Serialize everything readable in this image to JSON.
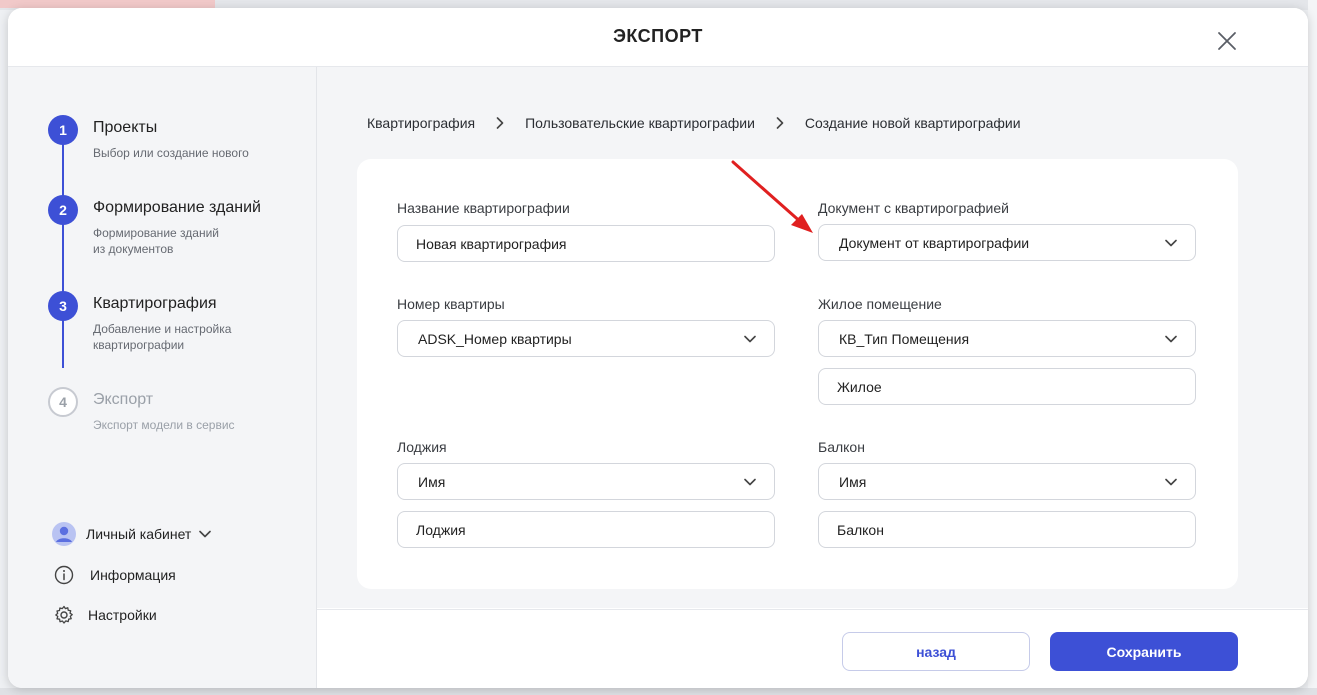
{
  "modal": {
    "title": "ЭКСПОРТ"
  },
  "steps": [
    {
      "number": "1",
      "title": "Проекты",
      "subtitle": "Выбор или создание нового",
      "state": "done"
    },
    {
      "number": "2",
      "title": "Формирование зданий",
      "subtitle": "Формирование зданий\nиз документов",
      "state": "done"
    },
    {
      "number": "3",
      "title": "Квартирография",
      "subtitle": "Добавление и настройка\nквартирографии",
      "state": "active"
    },
    {
      "number": "4",
      "title": "Экспорт",
      "subtitle": "Экспорт модели в сервис",
      "state": "inactive"
    }
  ],
  "side_menu": {
    "account": "Личный кабинет",
    "info": "Информация",
    "settings": "Настройки"
  },
  "breadcrumb": [
    "Квартирография",
    "Пользовательские квартирографии",
    "Создание новой квартирографии"
  ],
  "form": {
    "name_label": "Название квартирографии",
    "name_value": "Новая квартирография",
    "document_label": "Документ с квартирографией",
    "document_value": "Документ от квартирографии",
    "apartment_number_label": "Номер квартиры",
    "apartment_number_value": "ADSK_Номер квартиры",
    "living_label": "Жилое помещение",
    "living_param_value": "КВ_Тип Помещения",
    "living_value": "Жилое",
    "loggia_label": "Лоджия",
    "loggia_param_value": "Имя",
    "loggia_value": "Лоджия",
    "balcony_label": "Балкон",
    "balcony_param_value": "Имя",
    "balcony_value": "Балкон"
  },
  "footer": {
    "back_label": "назад",
    "save_label": "Сохранить"
  },
  "colors": {
    "accent": "#3d50d6",
    "annotation_arrow": "#e02020"
  }
}
